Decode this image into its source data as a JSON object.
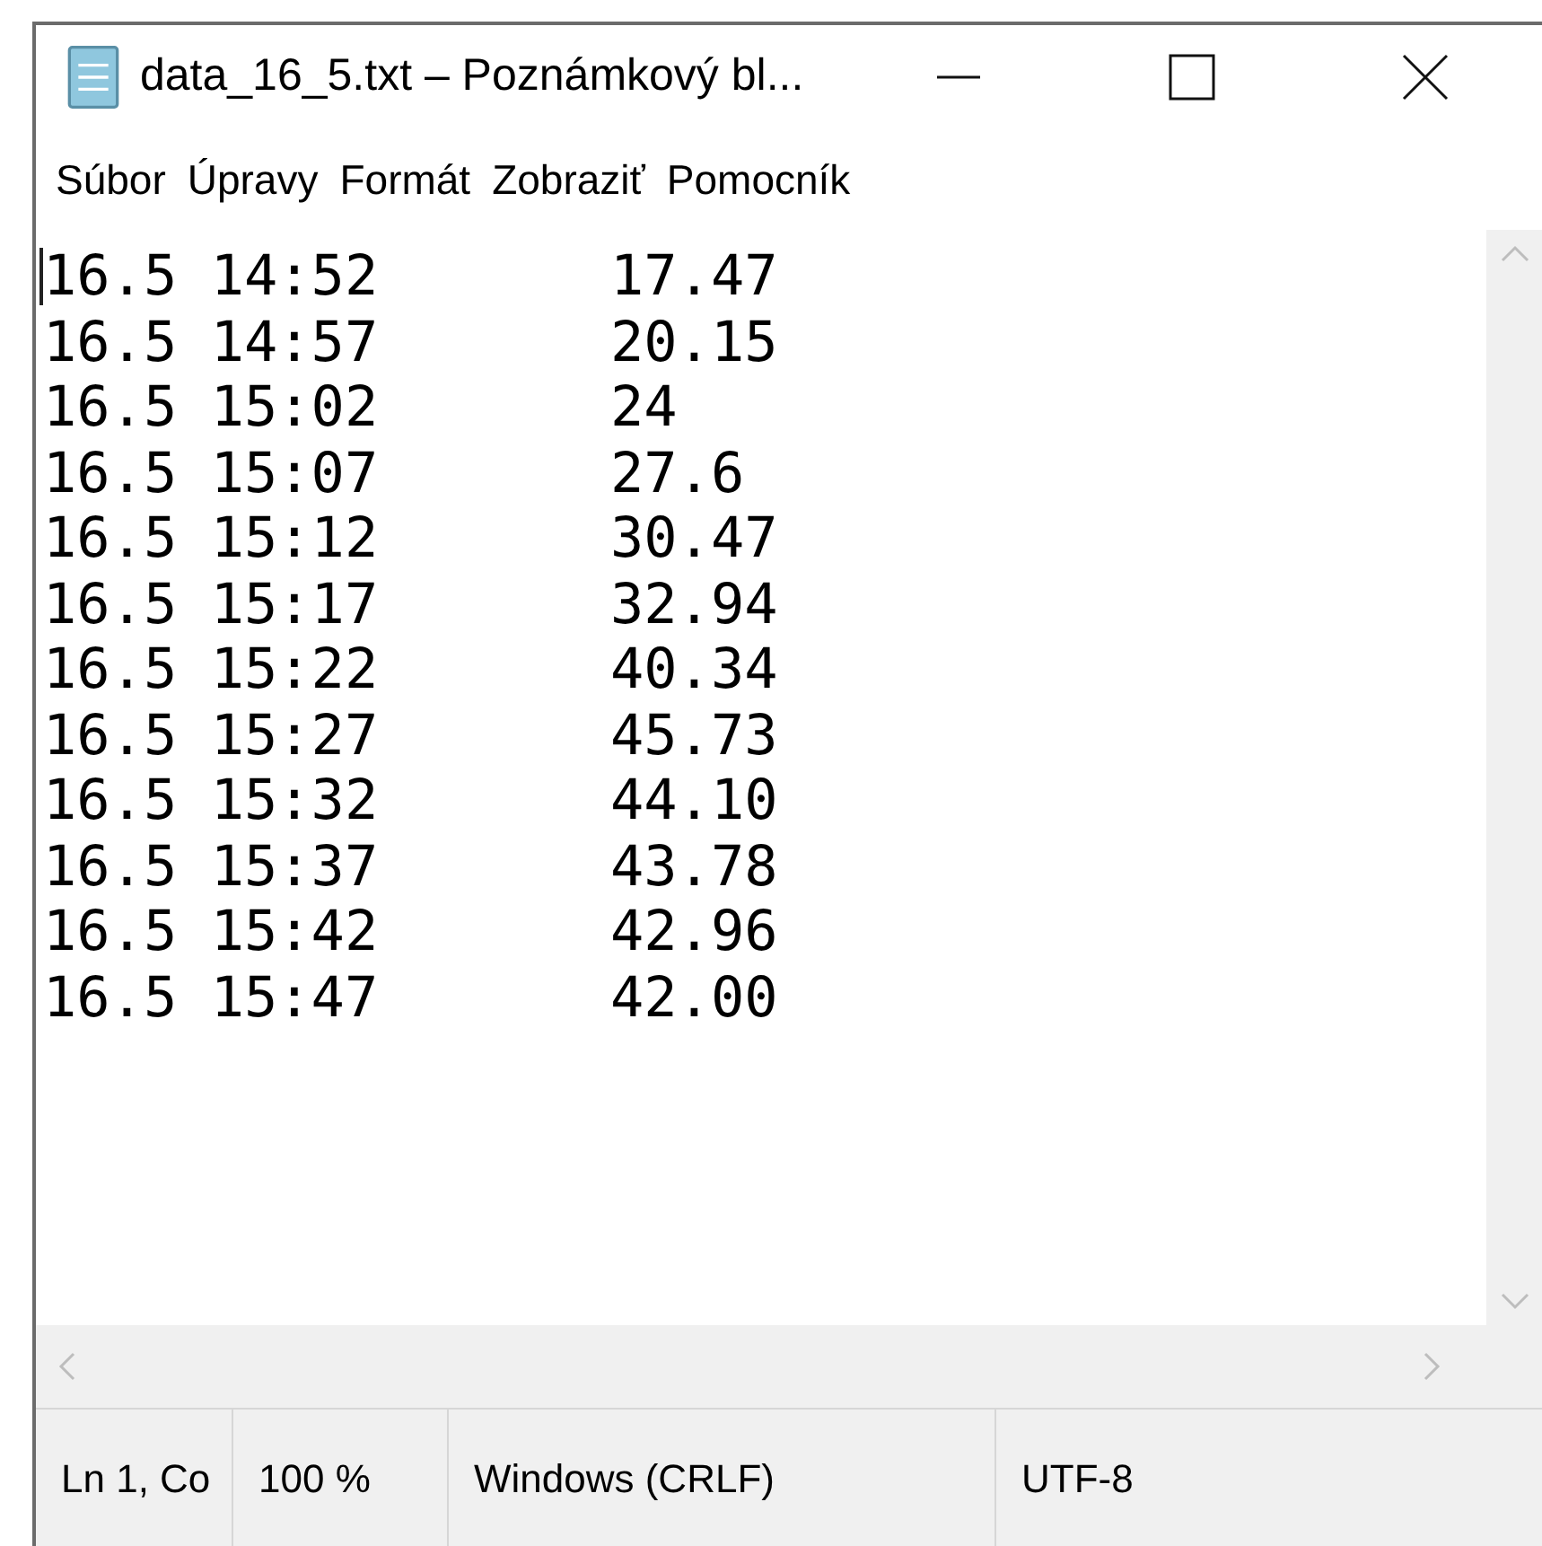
{
  "window": {
    "title": "data_16_5.txt – Poznámkový bl..."
  },
  "menu": [
    "Súbor",
    "Úpravy",
    "Formát",
    "Zobraziť",
    "Pomocník"
  ],
  "lines": [
    {
      "time": "16.5 14:52",
      "value": "17.47"
    },
    {
      "time": "16.5 14:57",
      "value": "20.15"
    },
    {
      "time": "16.5 15:02",
      "value": "24"
    },
    {
      "time": "16.5 15:07",
      "value": "27.6"
    },
    {
      "time": "16.5 15:12",
      "value": "30.47"
    },
    {
      "time": "16.5 15:17",
      "value": "32.94"
    },
    {
      "time": "16.5 15:22",
      "value": "40.34"
    },
    {
      "time": "16.5 15:27",
      "value": "45.73"
    },
    {
      "time": "16.5 15:32",
      "value": "44.10"
    },
    {
      "time": "16.5 15:37",
      "value": "43.78"
    },
    {
      "time": "16.5 15:42",
      "value": "42.96"
    },
    {
      "time": "16.5 15:47",
      "value": "42.00"
    }
  ],
  "status_bar": [
    "Ln 1, Co",
    "100 %",
    "Windows (CRLF)",
    "UTF-8"
  ]
}
